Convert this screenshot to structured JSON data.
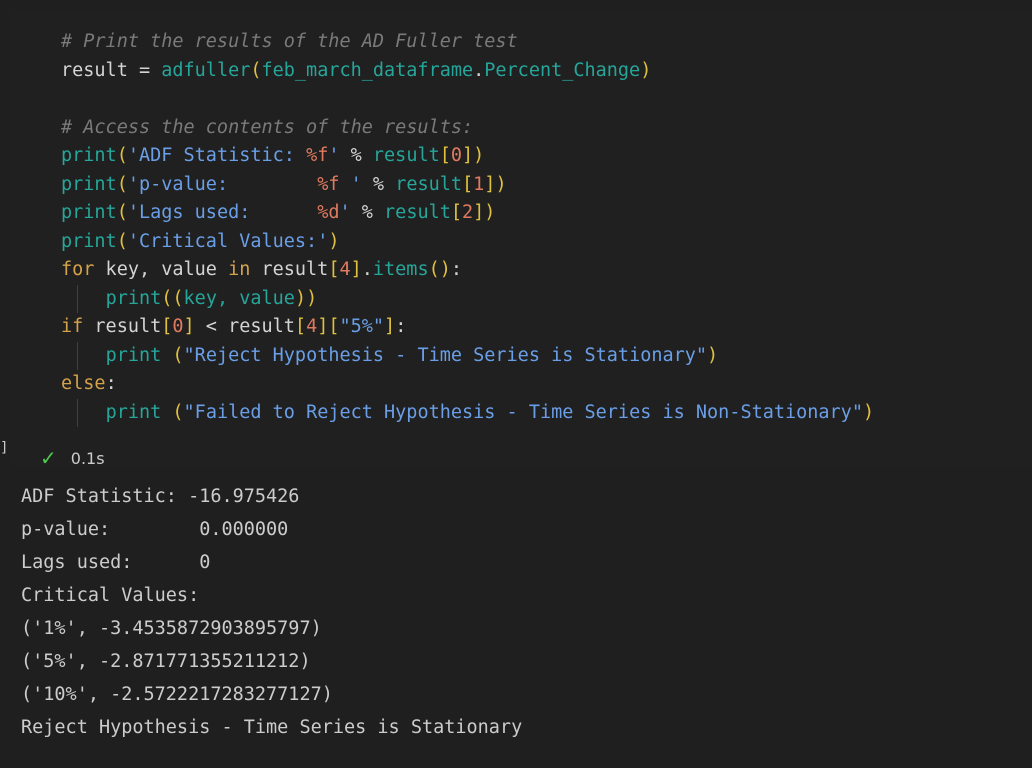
{
  "code": {
    "lines": [
      [
        {
          "t": "# Print the results of the AD Fuller test",
          "c": "cmt"
        }
      ],
      [
        {
          "t": "result",
          "c": "var"
        },
        {
          "t": " = ",
          "c": "op"
        },
        {
          "t": "adfuller",
          "c": "fn"
        },
        {
          "t": "(",
          "c": "br"
        },
        {
          "t": "feb_march_dataframe",
          "c": "attr"
        },
        {
          "t": ".",
          "c": "op"
        },
        {
          "t": "Percent_Change",
          "c": "attr"
        },
        {
          "t": ")",
          "c": "br"
        }
      ],
      [],
      [
        {
          "t": "# Access the contents of the results:",
          "c": "cmt"
        }
      ],
      [
        {
          "t": "print",
          "c": "fn"
        },
        {
          "t": "(",
          "c": "br"
        },
        {
          "t": "'ADF Statistic: ",
          "c": "str"
        },
        {
          "t": "%f",
          "c": "fmt"
        },
        {
          "t": "'",
          "c": "str"
        },
        {
          "t": " % ",
          "c": "op"
        },
        {
          "t": "result",
          "c": "attr"
        },
        {
          "t": "[",
          "c": "br"
        },
        {
          "t": "0",
          "c": "num"
        },
        {
          "t": "]",
          "c": "br"
        },
        {
          "t": ")",
          "c": "br"
        }
      ],
      [
        {
          "t": "print",
          "c": "fn"
        },
        {
          "t": "(",
          "c": "br"
        },
        {
          "t": "'p-value:        ",
          "c": "str"
        },
        {
          "t": "%f",
          "c": "fmt"
        },
        {
          "t": " '",
          "c": "str"
        },
        {
          "t": " % ",
          "c": "op"
        },
        {
          "t": "result",
          "c": "attr"
        },
        {
          "t": "[",
          "c": "br"
        },
        {
          "t": "1",
          "c": "num"
        },
        {
          "t": "]",
          "c": "br"
        },
        {
          "t": ")",
          "c": "br"
        }
      ],
      [
        {
          "t": "print",
          "c": "fn"
        },
        {
          "t": "(",
          "c": "br"
        },
        {
          "t": "'Lags used:      ",
          "c": "str"
        },
        {
          "t": "%d",
          "c": "fmt"
        },
        {
          "t": "'",
          "c": "str"
        },
        {
          "t": " % ",
          "c": "op"
        },
        {
          "t": "result",
          "c": "attr"
        },
        {
          "t": "[",
          "c": "br"
        },
        {
          "t": "2",
          "c": "num"
        },
        {
          "t": "]",
          "c": "br"
        },
        {
          "t": ")",
          "c": "br"
        }
      ],
      [
        {
          "t": "print",
          "c": "fn"
        },
        {
          "t": "(",
          "c": "br"
        },
        {
          "t": "'Critical Values:'",
          "c": "str"
        },
        {
          "t": ")",
          "c": "br"
        }
      ],
      [
        {
          "t": "for",
          "c": "ctl"
        },
        {
          "t": " key, value ",
          "c": "var"
        },
        {
          "t": "in",
          "c": "ctl"
        },
        {
          "t": " result",
          "c": "var"
        },
        {
          "t": "[",
          "c": "br"
        },
        {
          "t": "4",
          "c": "num"
        },
        {
          "t": "]",
          "c": "br"
        },
        {
          "t": ".",
          "c": "op"
        },
        {
          "t": "items",
          "c": "fn"
        },
        {
          "t": "()",
          "c": "br"
        },
        {
          "t": ":",
          "c": "op"
        }
      ],
      [
        {
          "t": "    ",
          "c": "var"
        },
        {
          "t": "print",
          "c": "fn"
        },
        {
          "t": "((",
          "c": "br"
        },
        {
          "t": "key, value",
          "c": "attr"
        },
        {
          "t": "))",
          "c": "br"
        }
      ],
      [
        {
          "t": "if",
          "c": "ctl"
        },
        {
          "t": " result",
          "c": "var"
        },
        {
          "t": "[",
          "c": "br"
        },
        {
          "t": "0",
          "c": "num"
        },
        {
          "t": "]",
          "c": "br"
        },
        {
          "t": " < ",
          "c": "op"
        },
        {
          "t": "result",
          "c": "var"
        },
        {
          "t": "[",
          "c": "br"
        },
        {
          "t": "4",
          "c": "num"
        },
        {
          "t": "][",
          "c": "br"
        },
        {
          "t": "\"5%\"",
          "c": "str"
        },
        {
          "t": "]",
          "c": "br"
        },
        {
          "t": ":",
          "c": "op"
        }
      ],
      [
        {
          "t": "    ",
          "c": "var"
        },
        {
          "t": "print",
          "c": "fn"
        },
        {
          "t": " (",
          "c": "br"
        },
        {
          "t": "\"Reject Hypothesis - Time Series is Stationary\"",
          "c": "str"
        },
        {
          "t": ")",
          "c": "br"
        }
      ],
      [
        {
          "t": "else",
          "c": "ctl"
        },
        {
          "t": ":",
          "c": "op"
        }
      ],
      [
        {
          "t": "    ",
          "c": "var"
        },
        {
          "t": "print",
          "c": "fn"
        },
        {
          "t": " (",
          "c": "br"
        },
        {
          "t": "\"Failed to Reject Hypothesis - Time Series is Non-Stationary\"",
          "c": "str"
        },
        {
          "t": ")",
          "c": "br"
        }
      ]
    ]
  },
  "status": {
    "bracket": "]",
    "check_icon": "check-icon",
    "duration": "0.1s",
    "success_color": "#4ec94e"
  },
  "output": {
    "lines": [
      "ADF Statistic: -16.975426",
      "p-value:        0.000000",
      "Lags used:      0",
      "Critical Values:",
      "('1%', -3.4535872903895797)",
      "('5%', -2.871771355211212)",
      "('10%', -2.5722217283277127)",
      "Reject Hypothesis - Time Series is Stationary"
    ]
  }
}
